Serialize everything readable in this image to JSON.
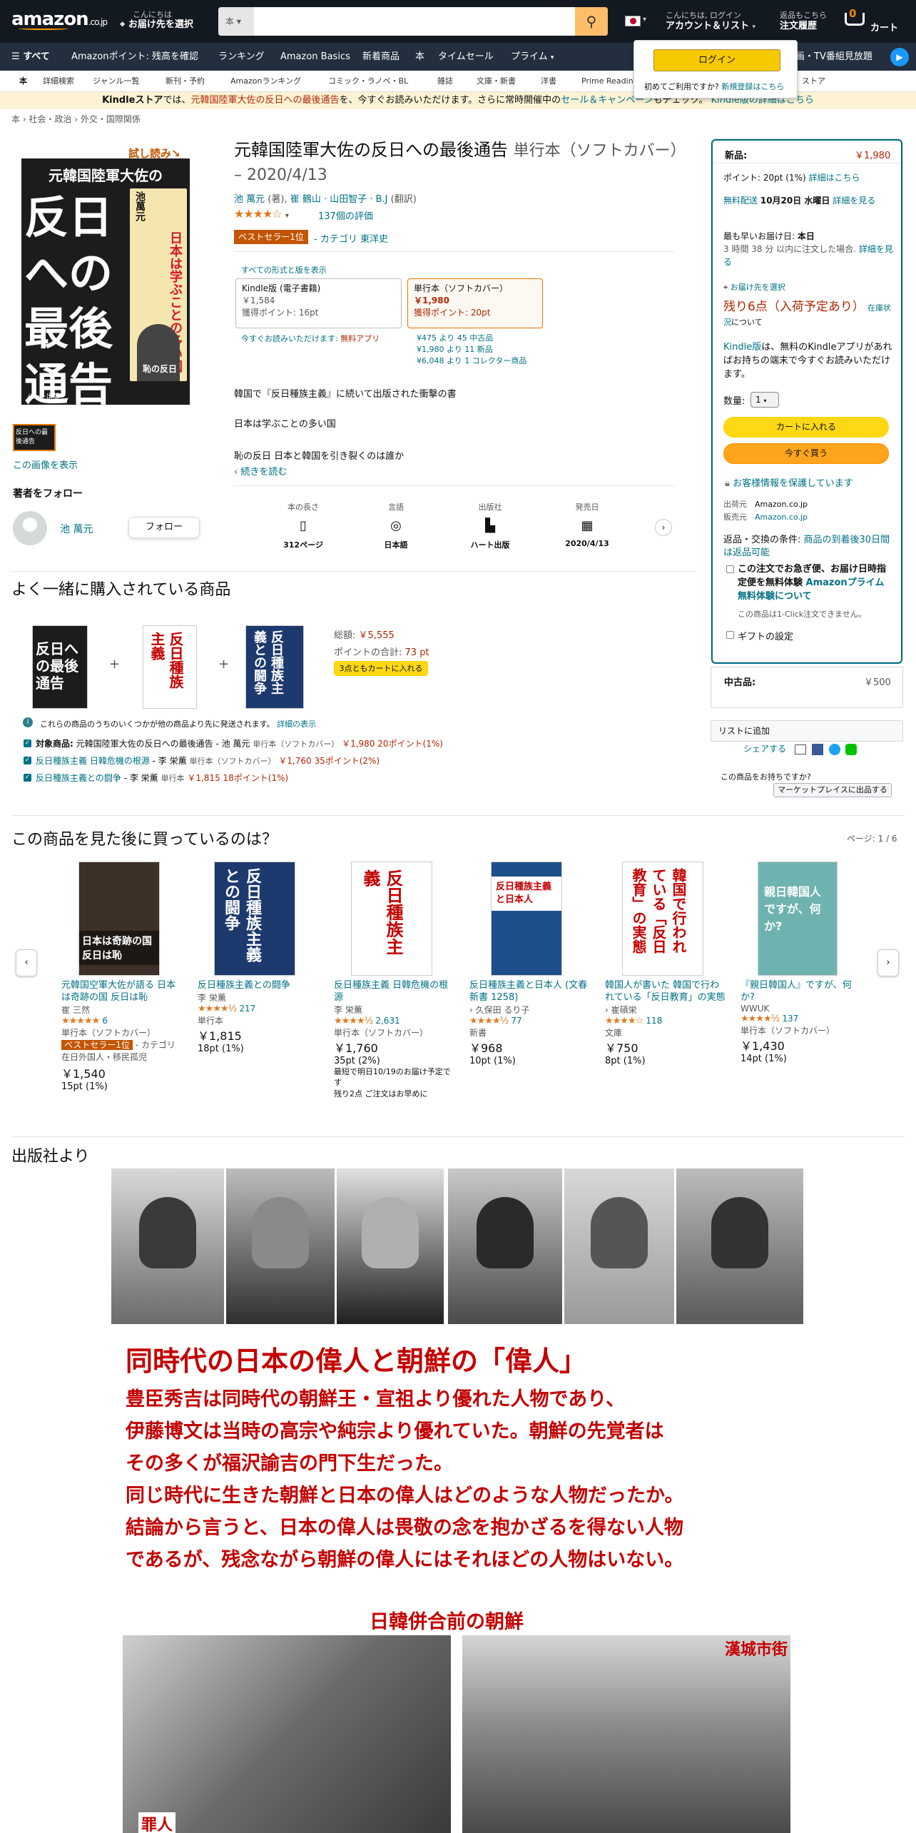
{
  "header": {
    "logo": "amazon",
    "logo_suffix": ".co.jp",
    "deliver_line1": "こんにちは",
    "deliver_line2": "お届け先を選択",
    "search_category": "本",
    "search_placeholder": "",
    "account_line1": "こんにちは, ログイン",
    "account_line2": "アカウント＆リスト",
    "orders_line1": "返品もこちら",
    "orders_line2": "注文履歴",
    "cart_count": "0",
    "cart_label": "カート"
  },
  "signin_popup": {
    "button": "ログイン",
    "text": "初めてご利用ですか?",
    "link": "新規登録はこちら"
  },
  "nav": {
    "menu": "すべて",
    "items": [
      "Amazonポイント: 残高を確認",
      "ランキング",
      "Amazon Basics",
      "新着商品",
      "本",
      "タイムセール",
      "プライム"
    ],
    "right": "映画・TV番組見放題"
  },
  "subnav": [
    "本",
    "詳細検索",
    "ジャンル一覧",
    "新刊・予約",
    "Amazonランキング",
    "コミック・ラノベ・BL",
    "雑誌",
    "文庫・新書",
    "洋書",
    "Prime Reading",
    "ストア"
  ],
  "banner": {
    "kindle": "Kindleストア",
    "text1": "では、",
    "link": "元韓国陸軍大佐の反日への最後通告",
    "text2": "を、今すぐお読みいただけます。さらに常時開催中の",
    "link2": "セール＆キャンペーン",
    "text3": "もチェック。",
    "link3": "Kindle版の詳細はこちら"
  },
  "breadcrumb": "本 › 社会・政治 › 外交・国際関係",
  "product": {
    "trial": "試し読み",
    "cover_title": "反日への最後通告",
    "cover_top": "元韓国陸軍大佐の",
    "cover_author": "池萬元",
    "cover_side": "日本は学ぶことの多い国",
    "cover_bottom": "恥の反日",
    "cover_publisher": "ハート出版",
    "show_image": "この画像を表示",
    "follow_heading": "著者をフォロー",
    "author_name": "池 萬元",
    "follow_button": "フォロー",
    "title": "元韓国陸軍大佐の反日への最後通告",
    "format": "単行本（ソフトカバー）",
    "date": " – 2020/4/13",
    "byline_author": "池 萬元",
    "byline_role": "(著),",
    "byline_translators": "崔 鶴山 · 山田智子 · B.J",
    "byline_trans_role": "(翻訳)",
    "stars": "★★★★☆",
    "ratings": "137個の評価",
    "bestseller": "ベストセラー1位",
    "category": "- カテゴリ 東洋史",
    "all_formats": "すべての形式と版を表示",
    "kindle_label": "Kindle版 (電子書籍)",
    "kindle_price": "￥1,584",
    "kindle_points": "獲得ポイント: 16pt",
    "kindle_unlimited_text": "今すぐお読みいただけます:",
    "kindle_unlimited_link": "無料アプリ",
    "paper_label": "単行本（ソフトカバー）",
    "paper_price": "￥1,980",
    "paper_points": "獲得ポイント: 20pt",
    "offer1": "¥475 より 45 中古品",
    "offer2": "¥1,980 より 11 新品",
    "offer3": "¥6,048 より 1 コレクター商品",
    "desc1": "韓国で『反日種族主義』に続いて出版された衝撃の書",
    "desc2": "日本は学ぶことの多い国",
    "desc3": "恥の反日 日本と韓国を引き裂くのは誰か",
    "read_more": "‹ 続きを読む",
    "attrs": [
      {
        "label": "本の長さ",
        "value": "312ページ"
      },
      {
        "label": "言語",
        "value": "日本語"
      },
      {
        "label": "出版社",
        "value": "ハート出版"
      },
      {
        "label": "発売日",
        "value": "2020/4/13"
      }
    ]
  },
  "buybox": {
    "new_label": "新品:",
    "price": "￥1,980",
    "points": "ポイント: 20pt (1%)",
    "points_link": "詳細はこちら",
    "free_ship": "無料配送",
    "ship_date": "10月20日 水曜日",
    "ship_link": "詳細を見る",
    "fastest": "最も早いお届け日:",
    "fastest_day": "本日",
    "fastest_note": "3 時間 38 分 以内に注文した場合.",
    "fastest_link": "詳細を見る",
    "deliver_to": "お届け先を選択",
    "stock": "残り6点（入荷予定あり）",
    "stock_link": "在庫状況",
    "stock_note": "について",
    "kindle_note_link": "Kindle版",
    "kindle_note": "は、無料のKindleアプリがあればお持ちの端末で今すぐお読みいただけます。",
    "qty_label": "数量:",
    "qty": "1",
    "add_cart": "カートに入れる",
    "buy_now": "今すぐ買う",
    "secure": "お客様情報を保護しています",
    "ship_from_label": "出荷元",
    "ship_from": "Amazon.co.jp",
    "seller_label": "販売元",
    "seller": "Amazon.co.jp",
    "returns_label": "返品・交換の条件:",
    "returns_link": "商品の到着後30日間は返品可能",
    "prime_check": "この注文でお急ぎ便、お届け日時指定便を無料体験",
    "prime_link": "Amazonプライム無料体験について",
    "oneclick": "この商品は1-Click注文できません。",
    "gift": "ギフトの設定",
    "used_label": "中古品:",
    "used_price": "￥500",
    "add_list": "リストに追加",
    "share": "シェアする",
    "sell_q": "この商品をお持ちですか?",
    "sell_btn": "マーケットプレイスに出品する"
  },
  "fbt": {
    "heading": "よく一緒に購入されている商品",
    "total_label": "総額:",
    "total": "￥5,555",
    "points_label": "ポイントの合計:",
    "points": "73 pt",
    "add_all": "3点ともカートに入れる",
    "info": "これらの商品のうちのいくつかが他の商品より先に発送されます。",
    "info_link": "詳細の表示",
    "items": [
      {
        "prefix": "対象商品:",
        "title": "元韓国陸軍大佐の反日への最後通告 - 池 萬元",
        "format": "単行本（ソフトカバー）",
        "price": "￥1,980",
        "points": "20ポイント(1%)"
      },
      {
        "prefix": "",
        "title": "反日種族主義 日韓危機の根源",
        "by": "- 李 栄薫",
        "format": "単行本（ソフトカバー）",
        "price": "￥1,760",
        "points": "35ポイント(2%)"
      },
      {
        "prefix": "",
        "title": "反日種族主義との闘争",
        "by": "- 李 栄薫",
        "format": "単行本",
        "price": "￥1,815",
        "points": "18ポイント(1%)"
      }
    ],
    "covers": [
      "反日への最後通告",
      "反日種族主義",
      "反日種族主義との闘争"
    ]
  },
  "also": {
    "heading": "この商品を見た後に買っているのは？",
    "page": "ページ: 1 / 6",
    "cards": [
      {
        "title": "元韓国空軍大佐が語る 日本は奇跡の国 反日は恥",
        "author": "崔 三然",
        "stars": "★★★★★",
        "count": "6",
        "format": "単行本（ソフトカバー）",
        "badge": "ベストセラー1位",
        "badge_cat": "- カテゴリ 在日外国人・移民孤児",
        "price": "￥1,540",
        "points": "15pt (1%)",
        "cover": "日本は奇跡の国 反日は恥"
      },
      {
        "title": "反日種族主義との闘争",
        "author": "李 栄薫",
        "stars": "★★★★½",
        "count": "217",
        "format": "単行本",
        "price": "￥1,815",
        "points": "18pt (1%)",
        "cover": "反日種族主義との闘争"
      },
      {
        "title": "反日種族主義 日韓危機の根源",
        "author": "李 栄薫",
        "stars": "★★★★½",
        "count": "2,631",
        "format": "単行本（ソフトカバー）",
        "price": "￥1,760",
        "points": "35pt (2%)",
        "delivery": "最短で明日10/19のお届け予定です",
        "stock": "残り2点 ご注文はお早めに",
        "cover": "反日種族主義"
      },
      {
        "title": "反日種族主義と日本人 (文春新書 1258)",
        "author": "› 久保田 るり子",
        "stars": "★★★★½",
        "count": "77",
        "format": "新書",
        "price": "￥968",
        "points": "10pt (1%)",
        "cover": "反日種族主義と日本人"
      },
      {
        "title": "韓国人が書いた 韓国で行われている「反日教育」の実態",
        "author": "› 崔碩栄",
        "stars": "★★★★☆",
        "count": "118",
        "format": "文庫",
        "price": "￥750",
        "points": "8pt (1%)",
        "cover": "韓国で行われている「反日教育」の実態"
      },
      {
        "title": "『親日韓国人』ですが、何か?",
        "author": "WWUK",
        "stars": "★★★★½",
        "count": "137",
        "format": "単行本（ソフトカバー）",
        "price": "￥1,430",
        "points": "14pt (1%)",
        "cover": "親日韓国人ですが、何か?"
      }
    ]
  },
  "publisher": {
    "heading": "出版社より",
    "h1": "同時代の日本の偉人と朝鮮の「偉人」",
    "lines": [
      "豊臣秀吉は同時代の朝鮮王・宣祖より優れた人物であり、",
      "伊藤博文は当時の高宗や純宗より優れていた。朝鮮の先覚者は",
      "その多くが福沢諭吉の門下生だった。",
      "同じ時代に生きた朝鮮と日本の偉人はどのような人物だったか。",
      "結論から言うと、日本の偉人は畏敬の念を抱かざるを得ない人物",
      "であるが、残念ながら朝鮮の偉人にはそれほどの人物はいない。"
    ],
    "h2": "日韓併合前の朝鮮",
    "caption_left": "罪人",
    "caption_right": "漢城市街"
  },
  "colors": {
    "header": "#131921",
    "nav": "#232f3e",
    "link": "#007185",
    "price": "#b12704",
    "yellow": "#ffd814",
    "orange": "#ffa41c",
    "heading_red": "#c40000"
  }
}
